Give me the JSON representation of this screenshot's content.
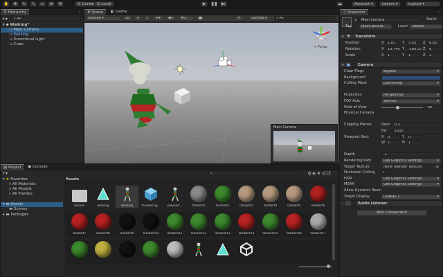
{
  "toolbar": {
    "center": "Center",
    "local": "Local",
    "account": "Account",
    "layers": "Layers",
    "layout": "Layout"
  },
  "hierarchy": {
    "tab": "Hierarchy",
    "search": "All",
    "items": [
      {
        "label": "Walking*",
        "depth": 0,
        "selected": false,
        "bold": true
      },
      {
        "label": "Main Camera",
        "depth": 1,
        "selected": true
      },
      {
        "label": "Walking",
        "depth": 1,
        "selected": false,
        "blue": true
      },
      {
        "label": "Directional Light",
        "depth": 1,
        "selected": false
      },
      {
        "label": "Cube",
        "depth": 1,
        "selected": false
      }
    ]
  },
  "scene": {
    "tab_scene": "Scene",
    "tab_game": "Game",
    "shading": "Shaded",
    "mode2d": "2D",
    "gizmos": "Gizmos",
    "search": "All",
    "persp": "< Persp",
    "snap": "0",
    "preview_title": "Main Camera"
  },
  "inspector": {
    "tab": "Inspector",
    "name": "Main Camera",
    "static": "Static",
    "tag_label": "Tag",
    "tag": "MainCamera",
    "layer_label": "Layer",
    "layer": "Default",
    "transform": {
      "title": "Transform",
      "position_label": "Position",
      "rotation_label": "Rotation",
      "scale_label": "Scale",
      "position": [
        "1.81",
        "5.05",
        "6.85"
      ],
      "rotation": [
        "19.746",
        "-180.37",
        "0"
      ],
      "scale": [
        "1",
        "1",
        "1"
      ],
      "axes": [
        "X",
        "Y",
        "Z"
      ]
    },
    "camera": {
      "title": "Camera",
      "rows": [
        {
          "label": "Clear Flags",
          "value": "Skybox",
          "kind": "dd"
        },
        {
          "label": "Background",
          "value": "",
          "kind": "color"
        },
        {
          "label": "Culling Mask",
          "value": "Everything",
          "kind": "dd"
        },
        {
          "label": "",
          "value": "",
          "kind": "gap"
        },
        {
          "label": "Projection",
          "value": "Perspective",
          "kind": "dd"
        },
        {
          "label": "FOV Axis",
          "value": "Vertical",
          "kind": "dd"
        },
        {
          "label": "Field of View",
          "value": "60",
          "kind": "slider"
        },
        {
          "label": "Physical Camera",
          "value": "",
          "kind": "check"
        },
        {
          "label": "",
          "value": "",
          "kind": "gap"
        },
        {
          "label": "Clipping Planes",
          "value": "",
          "kind": "clip"
        },
        {
          "label": "",
          "value": "",
          "kind": "clip2"
        },
        {
          "label": "Viewport Rect",
          "value": "",
          "kind": "vp1"
        },
        {
          "label": "",
          "value": "",
          "kind": "vp2"
        },
        {
          "label": "",
          "value": "",
          "kind": "gap"
        },
        {
          "label": "Depth",
          "value": "-1",
          "kind": "text"
        },
        {
          "label": "Rendering Path",
          "value": "Use Graphics Settings",
          "kind": "dd"
        },
        {
          "label": "Target Texture",
          "value": "None (Render Texture)",
          "kind": "obj"
        },
        {
          "label": "Occlusion Culling",
          "value": "",
          "kind": "checked"
        },
        {
          "label": "HDR",
          "value": "Use Graphics Settings",
          "kind": "dd"
        },
        {
          "label": "MSAA",
          "value": "Use Graphics Settings",
          "kind": "dd"
        },
        {
          "label": "Allow Dynamic Resol",
          "value": "",
          "kind": "none"
        },
        {
          "label": "Target Display",
          "value": "Display 1",
          "kind": "dd"
        }
      ],
      "near_label": "Near",
      "near": "0.3",
      "far_label": "Far",
      "far": "1000",
      "vp_x": "0",
      "vp_y": "0",
      "vp_w": "1",
      "vp_h": "1"
    },
    "audio": "Audio Listener",
    "add_component": "Add Component"
  },
  "project": {
    "tab_project": "Project",
    "tab_console": "Console",
    "favorites": "Favorites",
    "fav_items": [
      "All Materials",
      "All Models",
      "All Prefabs"
    ],
    "assets": "Assets",
    "scenes": "Scenes",
    "packages": "Packages",
    "breadcrumb": "Assets",
    "count": "13",
    "rows": [
      [
        {
          "n": "Scenes",
          "t": "folder"
        },
        {
          "n": "walking",
          "t": "tri"
        },
        {
          "n": "Walking",
          "t": "fig",
          "sel": true
        },
        {
          "n": "mixamorig...",
          "t": "cube"
        },
        {
          "n": "polySurf...",
          "t": "fig"
        },
        {
          "n": "lambert1",
          "t": "sph",
          "c": "#8a8a8a"
        },
        {
          "n": "lambert2",
          "t": "sph",
          "c": "#3d8a2e"
        },
        {
          "n": "lambert3",
          "t": "sph",
          "c": "#b69a7f"
        },
        {
          "n": "lambert4",
          "t": "sph",
          "c": "#b69a7f"
        },
        {
          "n": "lambert5",
          "t": "sph",
          "c": "#b69a7f"
        },
        {
          "n": "lambert6",
          "t": "sph",
          "c": "#b02020"
        }
      ],
      [
        {
          "n": "lambert7",
          "t": "sph",
          "c": "#b82222"
        },
        {
          "n": "lambert8",
          "t": "sph",
          "c": "#b82222"
        },
        {
          "n": "lambert9",
          "t": "sph",
          "c": "#111111"
        },
        {
          "n": "lambert10",
          "t": "sph",
          "c": "#111111"
        },
        {
          "n": "lambert11",
          "t": "sph",
          "c": "#3d8a2e"
        },
        {
          "n": "lambert12",
          "t": "sph",
          "c": "#3d8a2e"
        },
        {
          "n": "lambert13",
          "t": "sph",
          "c": "#3d8a2e"
        },
        {
          "n": "lambert14",
          "t": "sph",
          "c": "#b82222"
        },
        {
          "n": "lambert15",
          "t": "sph",
          "c": "#3d8a2e"
        },
        {
          "n": "lambert16",
          "t": "sph",
          "c": "#b82222"
        },
        {
          "n": "lambert17",
          "t": "sph",
          "c": "#aaaaaa"
        }
      ],
      [
        {
          "n": "",
          "t": "sph",
          "c": "#3d8a2e"
        },
        {
          "n": "",
          "t": "sph",
          "c": "#c0b040"
        },
        {
          "n": "",
          "t": "sph",
          "c": "#111111"
        },
        {
          "n": "",
          "t": "sph",
          "c": "#3d8a2e"
        },
        {
          "n": "",
          "t": "sph",
          "c": "#bbbbbb"
        },
        {
          "n": "",
          "t": "fig"
        },
        {
          "n": "",
          "t": "tri"
        },
        {
          "n": "",
          "t": "unity"
        }
      ]
    ]
  }
}
